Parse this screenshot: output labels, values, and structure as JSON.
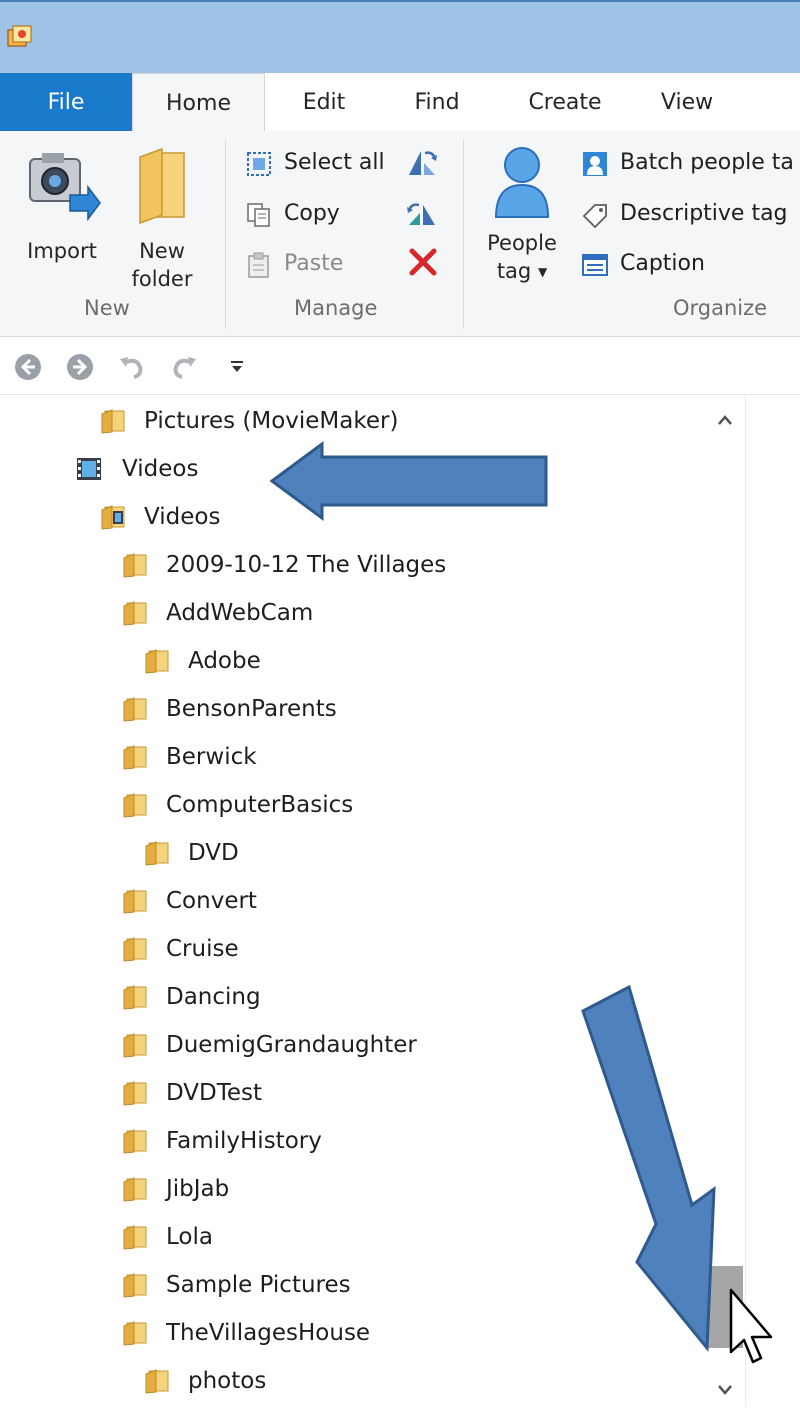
{
  "colors": {
    "accent": "#1979ca",
    "titlebar": "#9ec3e6",
    "annotation_arrow": "#4f81bd",
    "folder": "#f4c867"
  },
  "tabs": [
    "File",
    "Home",
    "Edit",
    "Find",
    "Create",
    "View"
  ],
  "ribbon": {
    "new_group": {
      "label": "New",
      "import_label": "Import",
      "new_label": "New",
      "folder_label": "folder"
    },
    "manage_group": {
      "label": "Manage",
      "select_all": "Select all",
      "copy": "Copy",
      "paste": "Paste"
    },
    "organize_group": {
      "label": "Organize",
      "people_label": "People",
      "tag_label": "tag",
      "batch_people": "Batch people ta",
      "descriptive_tag": "Descriptive tag",
      "caption": "Caption"
    }
  },
  "quick_access": [
    "back-icon",
    "forward-icon",
    "undo-icon",
    "redo-icon",
    "customize-dropdown-icon"
  ],
  "tree": [
    {
      "label": "Pictures (MovieMaker)",
      "icon": "folder-icon"
    },
    {
      "label": "Videos",
      "icon": "video-library-icon"
    },
    {
      "label": "Videos",
      "icon": "video-folder-icon"
    },
    {
      "label": "2009-10-12 The Villages",
      "icon": "folder-icon"
    },
    {
      "label": "AddWebCam",
      "icon": "folder-icon"
    },
    {
      "label": "Adobe",
      "icon": "folder-icon"
    },
    {
      "label": "BensonParents",
      "icon": "folder-icon"
    },
    {
      "label": "Berwick",
      "icon": "folder-icon"
    },
    {
      "label": "ComputerBasics",
      "icon": "folder-icon"
    },
    {
      "label": "DVD",
      "icon": "folder-icon"
    },
    {
      "label": "Convert",
      "icon": "folder-icon"
    },
    {
      "label": "Cruise",
      "icon": "folder-icon"
    },
    {
      "label": "Dancing",
      "icon": "folder-icon"
    },
    {
      "label": "DuemigGrandaughter",
      "icon": "folder-icon"
    },
    {
      "label": "DVDTest",
      "icon": "folder-icon"
    },
    {
      "label": "FamilyHistory",
      "icon": "folder-icon"
    },
    {
      "label": "JibJab",
      "icon": "folder-icon"
    },
    {
      "label": "Lola",
      "icon": "folder-icon"
    },
    {
      "label": "Sample Pictures",
      "icon": "folder-icon"
    },
    {
      "label": "TheVillagesHouse",
      "icon": "folder-icon"
    },
    {
      "label": "photos",
      "icon": "folder-icon"
    }
  ]
}
